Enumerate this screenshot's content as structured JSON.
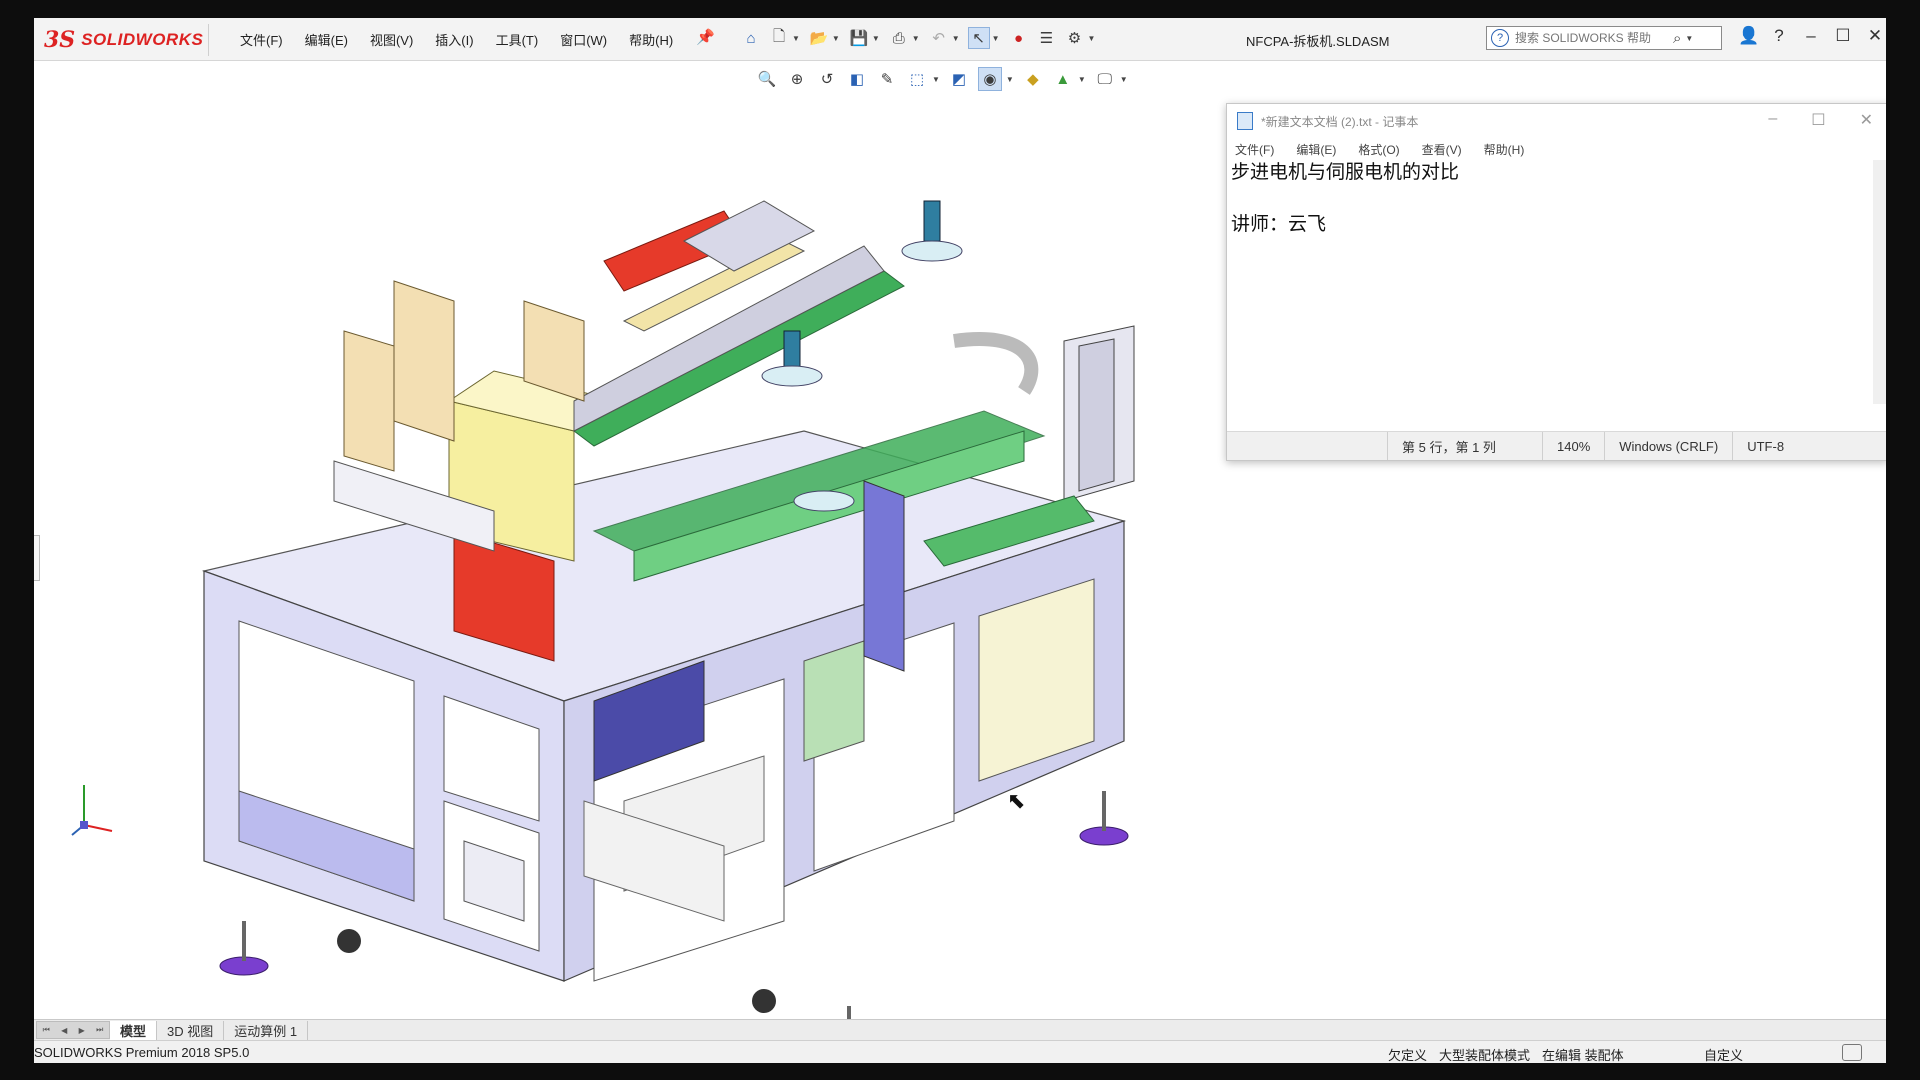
{
  "app": {
    "name": "SOLIDWORKS",
    "document_title": "NFCPA-拆板机.SLDASM",
    "menu": [
      "文件(F)",
      "编辑(E)",
      "视图(V)",
      "插入(I)",
      "工具(T)",
      "窗口(W)",
      "帮助(H)"
    ],
    "search_placeholder": "搜索 SOLIDWORKS 帮助",
    "toolbar_icons": [
      "home-icon",
      "new-file-icon",
      "open-folder-icon",
      "save-icon",
      "print-icon",
      "undo-icon",
      "select-pointer-icon",
      "rebuild-icon",
      "file-properties-icon",
      "options-gear-icon"
    ],
    "window_buttons": [
      "user-icon",
      "help-icon",
      "minimize-icon",
      "maximize-icon",
      "close-icon"
    ]
  },
  "heads_up_toolbar": [
    "zoom-to-fit-icon",
    "zoom-area-icon",
    "previous-view-icon",
    "section-view-icon",
    "dynamic-annotation-icon",
    "view-orientation-icon",
    "display-style-icon",
    "hide-show-icon",
    "edit-appearance-icon",
    "apply-scene-icon",
    "view-settings-icon"
  ],
  "notepad": {
    "title": "*新建文本文档 (2).txt - 记事本",
    "menu": [
      "文件(F)",
      "编辑(E)",
      "格式(O)",
      "查看(V)",
      "帮助(H)"
    ],
    "line1": "步进电机与伺服电机的对比",
    "line2": "",
    "line3": "讲师：云飞",
    "status_position": "第 5 行，第 1 列",
    "status_zoom": "140%",
    "status_eol": "Windows (CRLF)",
    "status_encoding": "UTF-8"
  },
  "tabs": [
    "模型",
    "3D 视图",
    "运动算例 1"
  ],
  "status": {
    "product": "SOLIDWORKS Premium 2018 SP5.0",
    "underdefined": "欠定义",
    "large_assembly_mode": "大型装配体模式",
    "editing": "在编辑 装配体",
    "custom": "自定义"
  },
  "colors": {
    "brand_red": "#d22222",
    "frame_lavender": "#dcdcf5",
    "gantry_yellow": "#f6efa0",
    "lift_red": "#e63a2a",
    "feet_purple": "#7a3fcf",
    "pcb_green": "#3fae5a"
  }
}
